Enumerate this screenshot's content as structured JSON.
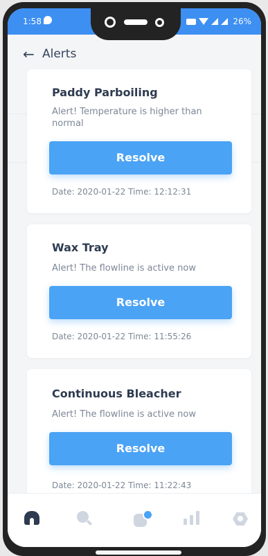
{
  "status_bar": {
    "time": "1:58",
    "battery": "26%"
  },
  "header": {
    "back_icon": "←",
    "title": "Alerts"
  },
  "alerts": [
    {
      "title": "Paddy Parboiling",
      "message": "Alert! Temperature is higher than normal",
      "button_label": "Resolve",
      "date_time": "Date: 2020-01-22 Time: 12:12:31"
    },
    {
      "title": "Wax Tray",
      "message": "Alert! The flowline is active now",
      "button_label": "Resolve",
      "date_time": "Date: 2020-01-22 Time: 11:55:26"
    },
    {
      "title": "Continuous Bleacher",
      "message": "Alert! The flowline is active now",
      "button_label": "Resolve",
      "date_time": "Date: 2020-01-22 Time: 11:22:43"
    }
  ],
  "bottom_nav": {
    "items": [
      "home-icon",
      "search-icon",
      "notification-icon",
      "chart-icon",
      "settings-icon"
    ],
    "active": "home-icon"
  },
  "colors": {
    "accent": "#4aa3f4",
    "status_bar": "#3d8ff2",
    "title_text": "#2e3b50",
    "muted_text": "#7d8796",
    "background": "#f4f5f7"
  }
}
